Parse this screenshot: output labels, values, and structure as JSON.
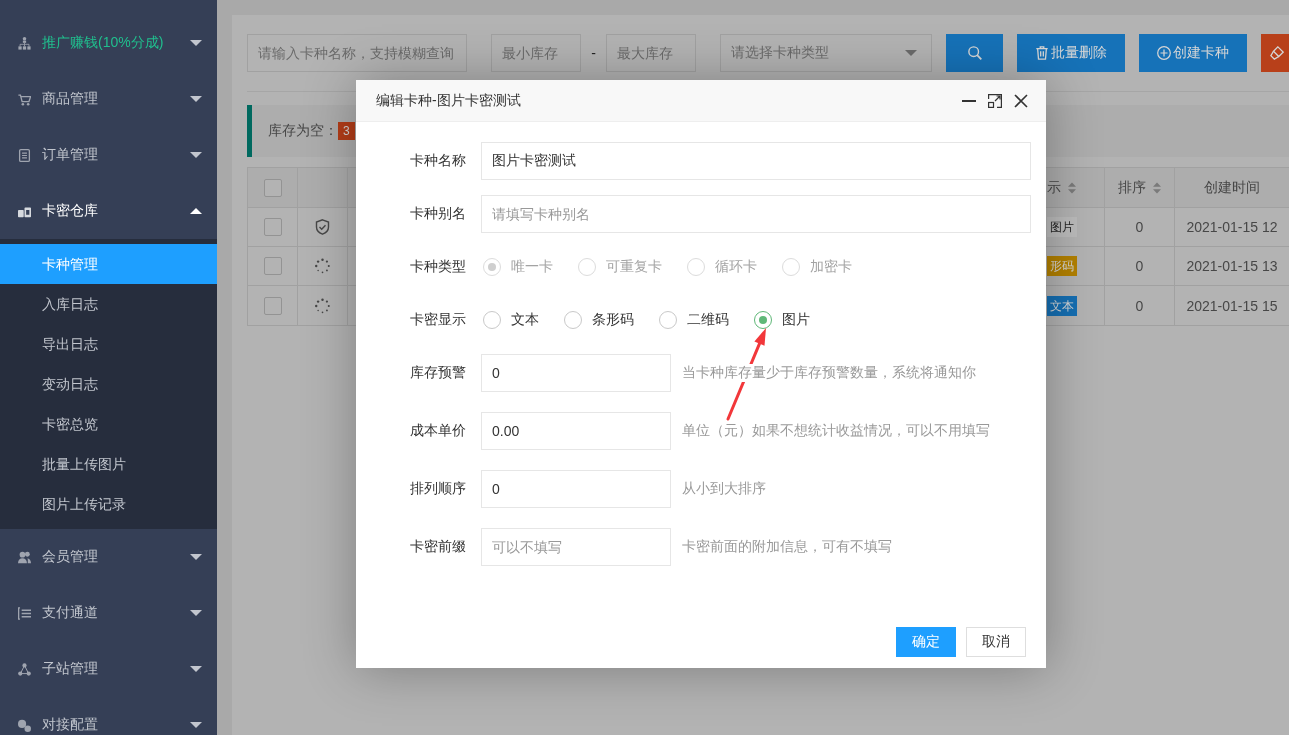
{
  "sidebar": {
    "items": [
      {
        "label": "推广赚钱(10%分成)",
        "kind": "promo",
        "expanded": false
      },
      {
        "label": "商品管理",
        "kind": "menu",
        "expanded": false
      },
      {
        "label": "订单管理",
        "kind": "menu",
        "expanded": false
      },
      {
        "label": "卡密仓库",
        "kind": "menu",
        "expanded": true,
        "children": [
          {
            "label": "卡种管理",
            "selected": true
          },
          {
            "label": "入库日志",
            "selected": false
          },
          {
            "label": "导出日志",
            "selected": false
          },
          {
            "label": "变动日志",
            "selected": false
          },
          {
            "label": "卡密总览",
            "selected": false
          },
          {
            "label": "批量上传图片",
            "selected": false
          },
          {
            "label": "图片上传记录",
            "selected": false
          }
        ]
      },
      {
        "label": "会员管理",
        "kind": "menu",
        "expanded": false
      },
      {
        "label": "支付通道",
        "kind": "menu",
        "expanded": false
      },
      {
        "label": "子站管理",
        "kind": "menu",
        "expanded": false
      },
      {
        "label": "对接配置",
        "kind": "menu",
        "expanded": false
      }
    ]
  },
  "toolbar": {
    "name_search": {
      "placeholder": "请输入卡种名称，支持模糊查询"
    },
    "min_stock": {
      "placeholder": "最小库存"
    },
    "range_separator": "-",
    "max_stock": {
      "placeholder": "最大库存"
    },
    "type_select": {
      "placeholder": "请选择卡种类型"
    },
    "buttons": [
      {
        "kind": "search"
      },
      {
        "kind": "delete",
        "label": "批量删除"
      },
      {
        "kind": "create",
        "label": "创建卡种"
      },
      {
        "kind": "brush"
      }
    ]
  },
  "notice": {
    "label": "库存为空：",
    "count": "3"
  },
  "table": {
    "all_checked": false,
    "columns": [
      {
        "label": "示",
        "sortable": true
      },
      {
        "label": "排序",
        "sortable": true
      },
      {
        "label": "创建时间",
        "sortable": false
      }
    ],
    "rows": [
      {
        "checked": false,
        "kind": "shield",
        "display": {
          "label": "图片",
          "color": "#bcbcbc"
        },
        "sort": "0",
        "created": "2021-01-15 12"
      },
      {
        "checked": false,
        "kind": "spinner",
        "display": {
          "label": "形码",
          "color": "#b38100"
        },
        "sort": "0",
        "created": "2021-01-15 13"
      },
      {
        "checked": false,
        "kind": "spinner",
        "display": {
          "label": "文本",
          "color": "#156fb3"
        },
        "sort": "0",
        "created": "2021-01-15 15"
      }
    ]
  },
  "dialog": {
    "title": "编辑卡种-图片卡密测试",
    "fields": [
      {
        "label": "卡种名称",
        "kind": "text",
        "value": "图片卡密测试"
      },
      {
        "label": "卡种别名",
        "kind": "text",
        "placeholder": "请填写卡种别名"
      },
      {
        "label": "卡种类型",
        "kind": "radio",
        "disabled": true,
        "options": [
          {
            "label": "唯一卡",
            "selected": true
          },
          {
            "label": "可重复卡",
            "selected": false
          },
          {
            "label": "循环卡",
            "selected": false
          },
          {
            "label": "加密卡",
            "selected": false
          }
        ]
      },
      {
        "label": "卡密显示",
        "kind": "radio",
        "disabled": false,
        "options": [
          {
            "label": "文本",
            "selected": false
          },
          {
            "label": "条形码",
            "selected": false
          },
          {
            "label": "二维码",
            "selected": false
          },
          {
            "label": "图片",
            "selected": true
          }
        ]
      },
      {
        "label": "库存预警",
        "kind": "short",
        "value": "0",
        "hint": "当卡种库存量少于库存预警数量，系统将通知你"
      },
      {
        "label": "成本单价",
        "kind": "short",
        "value": "0.00",
        "hint": "单位（元）如果不想统计收益情况，可以不用填写"
      },
      {
        "label": "排列顺序",
        "kind": "short",
        "value": "0",
        "hint": "从小到大排序"
      },
      {
        "label": "卡密前缀",
        "kind": "short",
        "placeholder": "可以不填写",
        "hint": "卡密前面的附加信息，可有不填写"
      }
    ],
    "buttons": [
      {
        "label": "确定",
        "kind": "primary"
      },
      {
        "label": "取消",
        "kind": "default"
      }
    ]
  }
}
